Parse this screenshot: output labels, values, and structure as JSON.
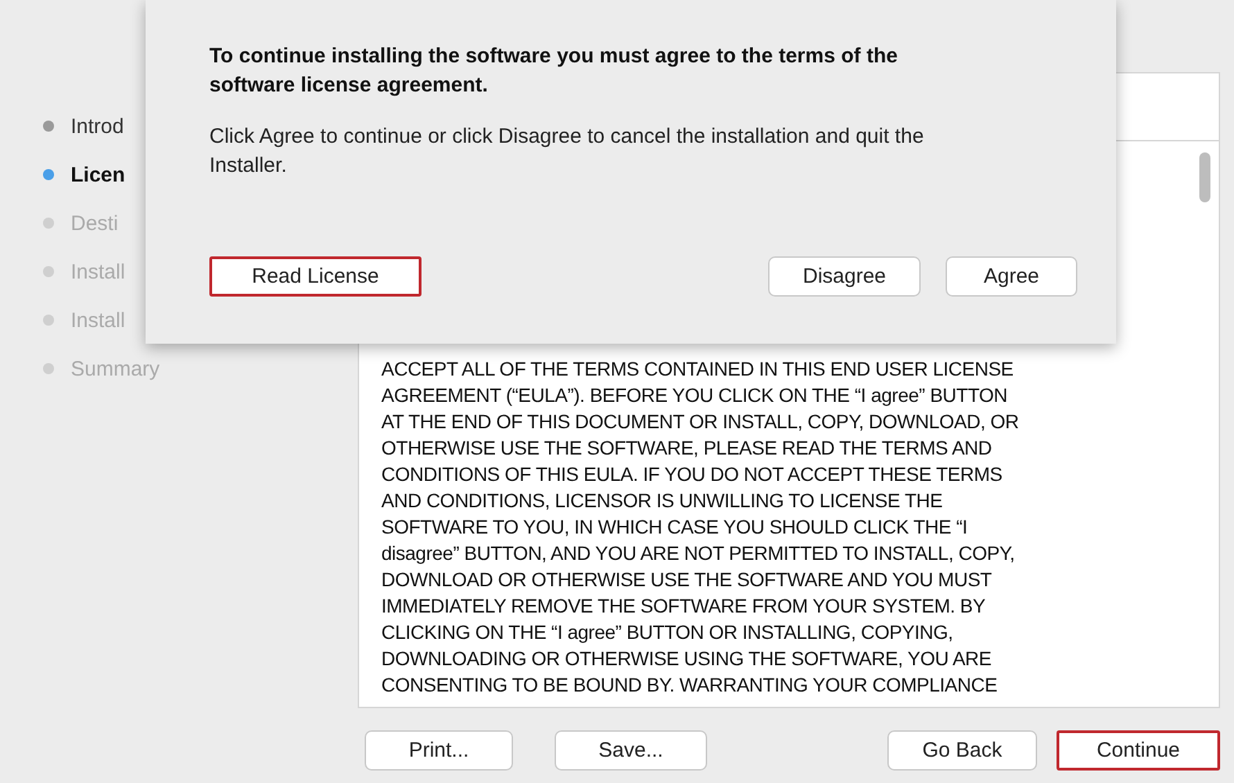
{
  "sidebar": {
    "steps": [
      {
        "label": "Introd",
        "selected": false,
        "completed": true
      },
      {
        "label": "Licen",
        "selected": true,
        "completed": false
      },
      {
        "label": "Desti",
        "selected": false,
        "completed": false
      },
      {
        "label": "Install",
        "selected": false,
        "completed": false
      },
      {
        "label": "Install",
        "selected": false,
        "completed": false
      },
      {
        "label": "Summary",
        "selected": false,
        "completed": false
      }
    ]
  },
  "license_text": [
    "ACCEPT ALL OF THE TERMS CONTAINED IN THIS END USER LICENSE",
    "AGREEMENT (“EULA”).  BEFORE YOU CLICK ON THE “I agree” BUTTON",
    "AT THE END OF THIS DOCUMENT OR INSTALL, COPY, DOWNLOAD, OR",
    "OTHERWISE USE THE SOFTWARE, PLEASE READ THE TERMS AND",
    "CONDITIONS OF THIS EULA.  IF YOU DO NOT ACCEPT THESE TERMS",
    "AND CONDITIONS, LICENSOR IS UNWILLING TO LICENSE THE",
    "SOFTWARE TO YOU, IN WHICH CASE YOU SHOULD CLICK THE “I",
    "disagree” BUTTON, AND YOU ARE NOT PERMITTED TO INSTALL, COPY,",
    "DOWNLOAD OR OTHERWISE USE THE SOFTWARE AND YOU MUST",
    "IMMEDIATELY REMOVE THE SOFTWARE FROM YOUR SYSTEM.  BY",
    "CLICKING ON THE “I agree” BUTTON OR INSTALLING, COPYING,",
    "DOWNLOADING OR OTHERWISE USING THE SOFTWARE, YOU ARE",
    "CONSENTING TO BE BOUND BY. WARRANTING YOUR COMPLIANCE"
  ],
  "bottom_buttons": [
    {
      "label": "Print...",
      "highlighted": false
    },
    {
      "label": "Save...",
      "highlighted": false
    },
    {
      "label": "Go Back",
      "highlighted": false
    },
    {
      "label": "Continue",
      "highlighted": true
    }
  ],
  "dialog": {
    "title": "To continue installing the software you must agree to the terms of the software license agreement.",
    "message": "Click Agree to continue or click Disagree to cancel the installation and quit the Installer.",
    "buttons": [
      {
        "label": "Read License",
        "highlighted": true
      },
      {
        "label": "Disagree",
        "highlighted": false
      },
      {
        "label": "Agree",
        "highlighted": false
      }
    ]
  }
}
